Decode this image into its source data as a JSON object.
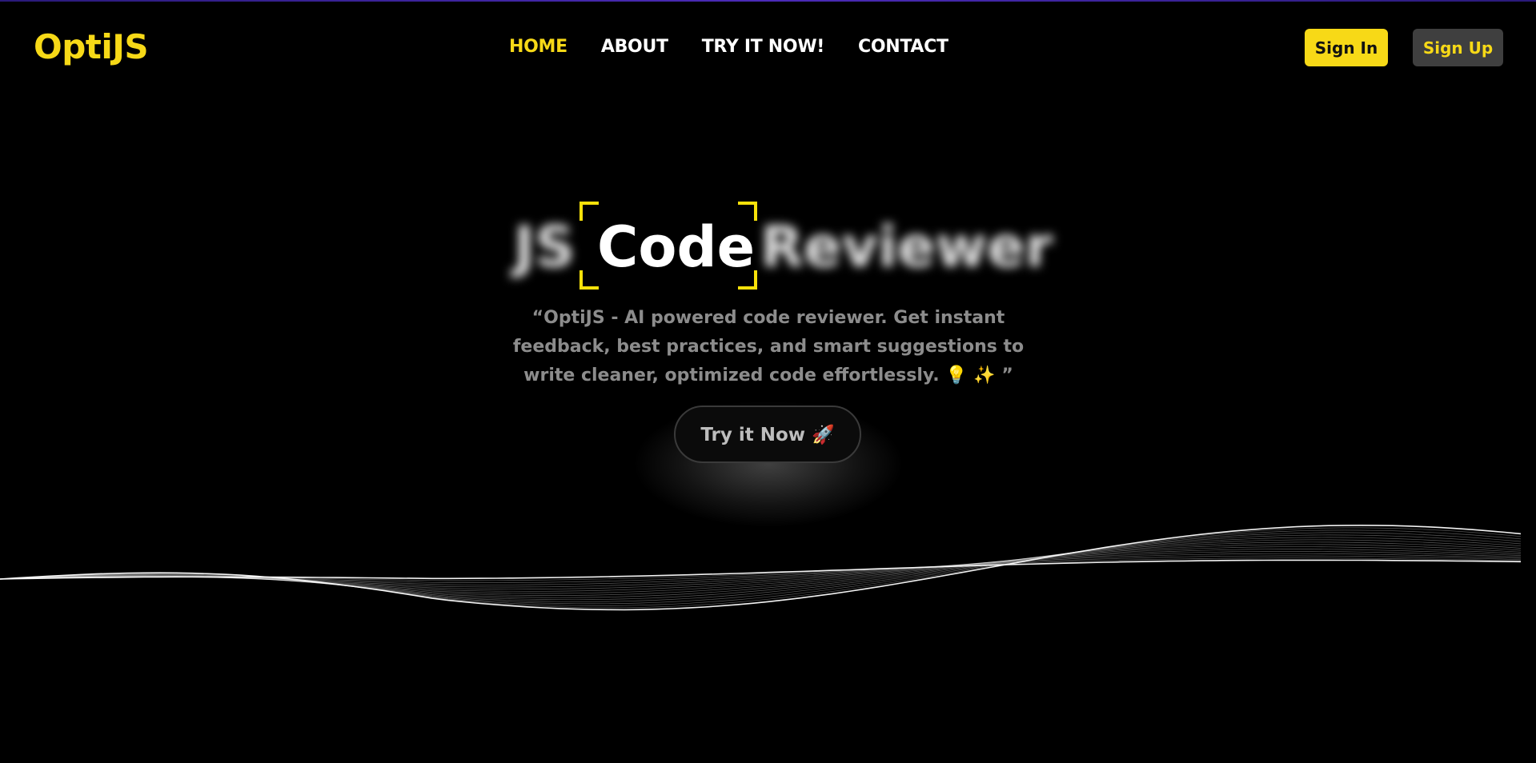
{
  "app": {
    "logo": "OptiJS"
  },
  "nav": {
    "items": [
      {
        "label": "HOME",
        "active": true
      },
      {
        "label": "ABOUT",
        "active": false
      },
      {
        "label": "TRY IT NOW!",
        "active": false
      },
      {
        "label": "CONTACT",
        "active": false
      }
    ]
  },
  "auth": {
    "signin_label": "Sign In",
    "signup_label": "Sign Up"
  },
  "hero": {
    "title_left": "JS",
    "title_focus": "Code",
    "title_right": "Reviewer",
    "tagline": "“OptiJS - AI powered code reviewer. Get instant feedback, best practices, and smart suggestions to write cleaner, optimized code effortlessly. 💡 ✨ ”",
    "cta_label": "Try it Now 🚀"
  },
  "colors": {
    "accent": "#f7d917",
    "background": "#000000",
    "signup_bg": "#3f3f3f",
    "tagline": "#8c8c8c"
  },
  "icons": [
    "lightbulb-icon",
    "sparkles-icon",
    "rocket-icon"
  ]
}
